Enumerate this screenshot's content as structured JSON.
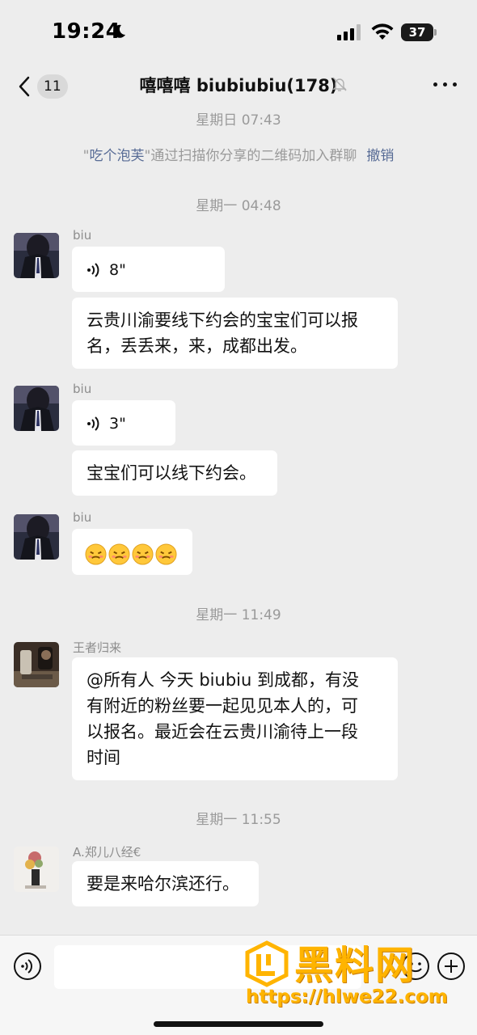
{
  "status_bar": {
    "time": "19:24",
    "battery": "37"
  },
  "nav": {
    "back_badge": "11",
    "title": "嘻嘻嘻 biubiubiu(178)"
  },
  "chat": {
    "timestamps": [
      "星期日 07:43",
      "星期一 04:48",
      "星期一 11:49",
      "星期一 11:55"
    ],
    "system": {
      "quote_open": "\"",
      "name": "吃个泡芙",
      "quote_close": "\"",
      "text": "通过扫描你分享的二维码加入群聊",
      "action": "撤销"
    },
    "groups": [
      {
        "sender": "biu",
        "voice_duration": "8\"",
        "text_line1": "云贵川渝要线下约会的宝宝们可以报",
        "text_line2": "名，丢丢来，来，成都出发。"
      },
      {
        "sender": "biu",
        "voice_duration": "3\"",
        "text": "宝宝们可以线下约会。"
      },
      {
        "sender": "biu",
        "emoji_count": 4
      },
      {
        "sender": "王者归来",
        "lines": [
          "@所有人 今天 biubiu 到成都，有没",
          "有附近的粉丝要一起见见本人的，可",
          "以报名。最近会在云贵川渝待上一段",
          "时间"
        ]
      },
      {
        "sender": "A.郑儿八经€",
        "text": "要是来哈尔滨还行。"
      }
    ]
  },
  "watermark": {
    "big_text": "黑料网",
    "url": "https://hlwe22.com"
  },
  "colors": {
    "background": "#ededed",
    "bubble": "#ffffff",
    "link": "#576b95",
    "watermark": "#ffb400"
  },
  "icons": [
    "moon-icon",
    "signal-icon",
    "wifi-icon",
    "battery-icon",
    "back-chevron-icon",
    "mute-bell-icon",
    "more-icon",
    "voice-icon",
    "emoji-icon",
    "plus-icon"
  ]
}
